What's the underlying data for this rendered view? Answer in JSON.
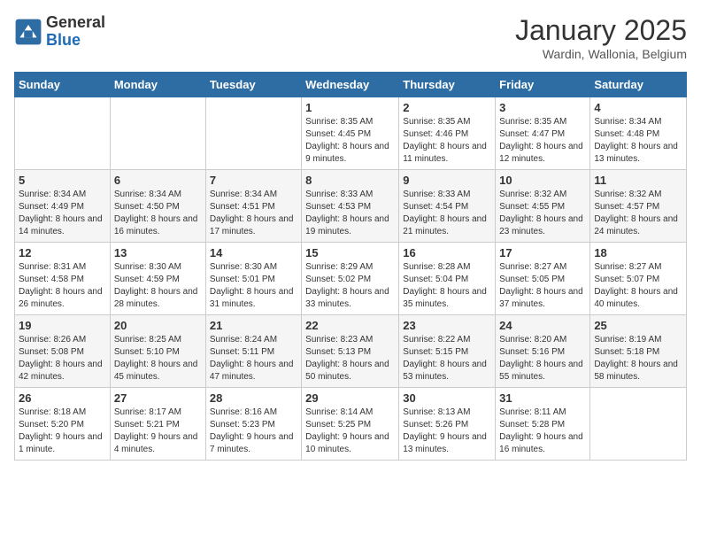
{
  "logo": {
    "general": "General",
    "blue": "Blue"
  },
  "title": "January 2025",
  "location": "Wardin, Wallonia, Belgium",
  "days_of_week": [
    "Sunday",
    "Monday",
    "Tuesday",
    "Wednesday",
    "Thursday",
    "Friday",
    "Saturday"
  ],
  "weeks": [
    [
      {
        "day": "",
        "sunrise": "",
        "sunset": "",
        "daylight": ""
      },
      {
        "day": "",
        "sunrise": "",
        "sunset": "",
        "daylight": ""
      },
      {
        "day": "",
        "sunrise": "",
        "sunset": "",
        "daylight": ""
      },
      {
        "day": "1",
        "sunrise": "Sunrise: 8:35 AM",
        "sunset": "Sunset: 4:45 PM",
        "daylight": "Daylight: 8 hours and 9 minutes."
      },
      {
        "day": "2",
        "sunrise": "Sunrise: 8:35 AM",
        "sunset": "Sunset: 4:46 PM",
        "daylight": "Daylight: 8 hours and 11 minutes."
      },
      {
        "day": "3",
        "sunrise": "Sunrise: 8:35 AM",
        "sunset": "Sunset: 4:47 PM",
        "daylight": "Daylight: 8 hours and 12 minutes."
      },
      {
        "day": "4",
        "sunrise": "Sunrise: 8:34 AM",
        "sunset": "Sunset: 4:48 PM",
        "daylight": "Daylight: 8 hours and 13 minutes."
      }
    ],
    [
      {
        "day": "5",
        "sunrise": "Sunrise: 8:34 AM",
        "sunset": "Sunset: 4:49 PM",
        "daylight": "Daylight: 8 hours and 14 minutes."
      },
      {
        "day": "6",
        "sunrise": "Sunrise: 8:34 AM",
        "sunset": "Sunset: 4:50 PM",
        "daylight": "Daylight: 8 hours and 16 minutes."
      },
      {
        "day": "7",
        "sunrise": "Sunrise: 8:34 AM",
        "sunset": "Sunset: 4:51 PM",
        "daylight": "Daylight: 8 hours and 17 minutes."
      },
      {
        "day": "8",
        "sunrise": "Sunrise: 8:33 AM",
        "sunset": "Sunset: 4:53 PM",
        "daylight": "Daylight: 8 hours and 19 minutes."
      },
      {
        "day": "9",
        "sunrise": "Sunrise: 8:33 AM",
        "sunset": "Sunset: 4:54 PM",
        "daylight": "Daylight: 8 hours and 21 minutes."
      },
      {
        "day": "10",
        "sunrise": "Sunrise: 8:32 AM",
        "sunset": "Sunset: 4:55 PM",
        "daylight": "Daylight: 8 hours and 23 minutes."
      },
      {
        "day": "11",
        "sunrise": "Sunrise: 8:32 AM",
        "sunset": "Sunset: 4:57 PM",
        "daylight": "Daylight: 8 hours and 24 minutes."
      }
    ],
    [
      {
        "day": "12",
        "sunrise": "Sunrise: 8:31 AM",
        "sunset": "Sunset: 4:58 PM",
        "daylight": "Daylight: 8 hours and 26 minutes."
      },
      {
        "day": "13",
        "sunrise": "Sunrise: 8:30 AM",
        "sunset": "Sunset: 4:59 PM",
        "daylight": "Daylight: 8 hours and 28 minutes."
      },
      {
        "day": "14",
        "sunrise": "Sunrise: 8:30 AM",
        "sunset": "Sunset: 5:01 PM",
        "daylight": "Daylight: 8 hours and 31 minutes."
      },
      {
        "day": "15",
        "sunrise": "Sunrise: 8:29 AM",
        "sunset": "Sunset: 5:02 PM",
        "daylight": "Daylight: 8 hours and 33 minutes."
      },
      {
        "day": "16",
        "sunrise": "Sunrise: 8:28 AM",
        "sunset": "Sunset: 5:04 PM",
        "daylight": "Daylight: 8 hours and 35 minutes."
      },
      {
        "day": "17",
        "sunrise": "Sunrise: 8:27 AM",
        "sunset": "Sunset: 5:05 PM",
        "daylight": "Daylight: 8 hours and 37 minutes."
      },
      {
        "day": "18",
        "sunrise": "Sunrise: 8:27 AM",
        "sunset": "Sunset: 5:07 PM",
        "daylight": "Daylight: 8 hours and 40 minutes."
      }
    ],
    [
      {
        "day": "19",
        "sunrise": "Sunrise: 8:26 AM",
        "sunset": "Sunset: 5:08 PM",
        "daylight": "Daylight: 8 hours and 42 minutes."
      },
      {
        "day": "20",
        "sunrise": "Sunrise: 8:25 AM",
        "sunset": "Sunset: 5:10 PM",
        "daylight": "Daylight: 8 hours and 45 minutes."
      },
      {
        "day": "21",
        "sunrise": "Sunrise: 8:24 AM",
        "sunset": "Sunset: 5:11 PM",
        "daylight": "Daylight: 8 hours and 47 minutes."
      },
      {
        "day": "22",
        "sunrise": "Sunrise: 8:23 AM",
        "sunset": "Sunset: 5:13 PM",
        "daylight": "Daylight: 8 hours and 50 minutes."
      },
      {
        "day": "23",
        "sunrise": "Sunrise: 8:22 AM",
        "sunset": "Sunset: 5:15 PM",
        "daylight": "Daylight: 8 hours and 53 minutes."
      },
      {
        "day": "24",
        "sunrise": "Sunrise: 8:20 AM",
        "sunset": "Sunset: 5:16 PM",
        "daylight": "Daylight: 8 hours and 55 minutes."
      },
      {
        "day": "25",
        "sunrise": "Sunrise: 8:19 AM",
        "sunset": "Sunset: 5:18 PM",
        "daylight": "Daylight: 8 hours and 58 minutes."
      }
    ],
    [
      {
        "day": "26",
        "sunrise": "Sunrise: 8:18 AM",
        "sunset": "Sunset: 5:20 PM",
        "daylight": "Daylight: 9 hours and 1 minute."
      },
      {
        "day": "27",
        "sunrise": "Sunrise: 8:17 AM",
        "sunset": "Sunset: 5:21 PM",
        "daylight": "Daylight: 9 hours and 4 minutes."
      },
      {
        "day": "28",
        "sunrise": "Sunrise: 8:16 AM",
        "sunset": "Sunset: 5:23 PM",
        "daylight": "Daylight: 9 hours and 7 minutes."
      },
      {
        "day": "29",
        "sunrise": "Sunrise: 8:14 AM",
        "sunset": "Sunset: 5:25 PM",
        "daylight": "Daylight: 9 hours and 10 minutes."
      },
      {
        "day": "30",
        "sunrise": "Sunrise: 8:13 AM",
        "sunset": "Sunset: 5:26 PM",
        "daylight": "Daylight: 9 hours and 13 minutes."
      },
      {
        "day": "31",
        "sunrise": "Sunrise: 8:11 AM",
        "sunset": "Sunset: 5:28 PM",
        "daylight": "Daylight: 9 hours and 16 minutes."
      },
      {
        "day": "",
        "sunrise": "",
        "sunset": "",
        "daylight": ""
      }
    ]
  ]
}
